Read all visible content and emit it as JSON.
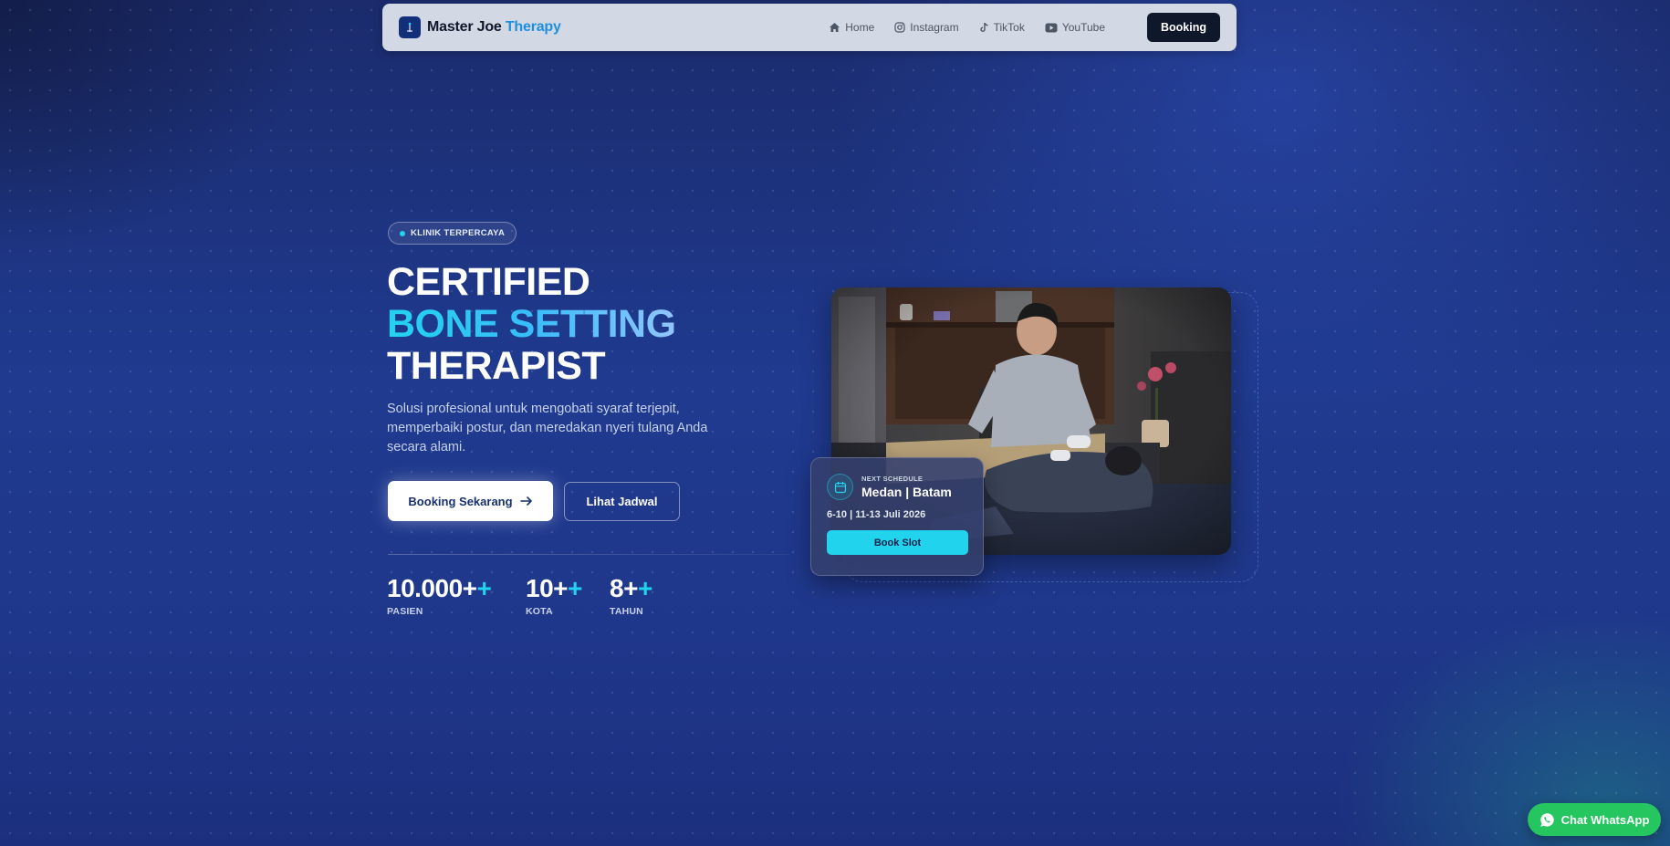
{
  "colors": {
    "accent": "#22d3ee",
    "brand_blue": "#1f8fe0",
    "nav_bg": "#d3d9e4",
    "dark": "#0f172a",
    "whatsapp": "#25c55f"
  },
  "nav": {
    "brand_main": "Master Joe ",
    "brand_accent": "Therapy",
    "links": [
      {
        "label": "Home",
        "icon": "home-icon"
      },
      {
        "label": "Instagram",
        "icon": "instagram-icon"
      },
      {
        "label": "TikTok",
        "icon": "tiktok-icon"
      },
      {
        "label": "YouTube",
        "icon": "youtube-icon"
      }
    ],
    "cta": "Booking"
  },
  "hero": {
    "badge": "KLINIK TERPERCAYA",
    "headline": [
      "CERTIFIED",
      "BONE SETTING",
      "THERAPIST"
    ],
    "description": "Solusi profesional untuk mengobati syaraf terjepit, memperbaiki postur, dan meredakan nyeri tulang Anda secara alami.",
    "primary_cta": "Booking Sekarang",
    "secondary_cta": "Lihat Jadwal",
    "stats": [
      {
        "value": "10.000+",
        "plus": "+",
        "label": "PASIEN"
      },
      {
        "value": "10+",
        "plus": "+",
        "label": "KOTA"
      },
      {
        "value": "8+",
        "plus": "+",
        "label": "TAHUN"
      }
    ]
  },
  "schedule": {
    "kicker": "NEXT SCHEDULE",
    "title": "Medan | Batam",
    "dates": "6-10 | 11-13 Juli 2026",
    "button": "Book Slot"
  },
  "whatsapp": {
    "label": "Chat WhatsApp"
  }
}
